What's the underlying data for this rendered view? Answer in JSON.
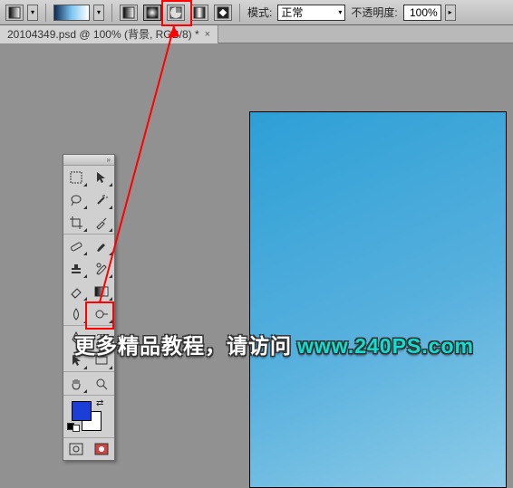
{
  "options_bar": {
    "mode_label": "模式:",
    "mode_value": "正常",
    "opacity_label": "不透明度:",
    "opacity_value": "100%"
  },
  "document_tab": {
    "title": "20104349.psd @ 100% (背景, RGB/8) *"
  },
  "watermark": {
    "cn": "更多精品教程，请访问",
    "url": "www.240PS.com"
  },
  "annotation": {
    "highlight_tool": "gradient-tool",
    "highlight_option": "radial-gradient-button"
  },
  "colors": {
    "foreground": "#1b3ed6",
    "background": "#ffffff",
    "workspace_gray": "#919191",
    "highlight": "#ff0000"
  }
}
